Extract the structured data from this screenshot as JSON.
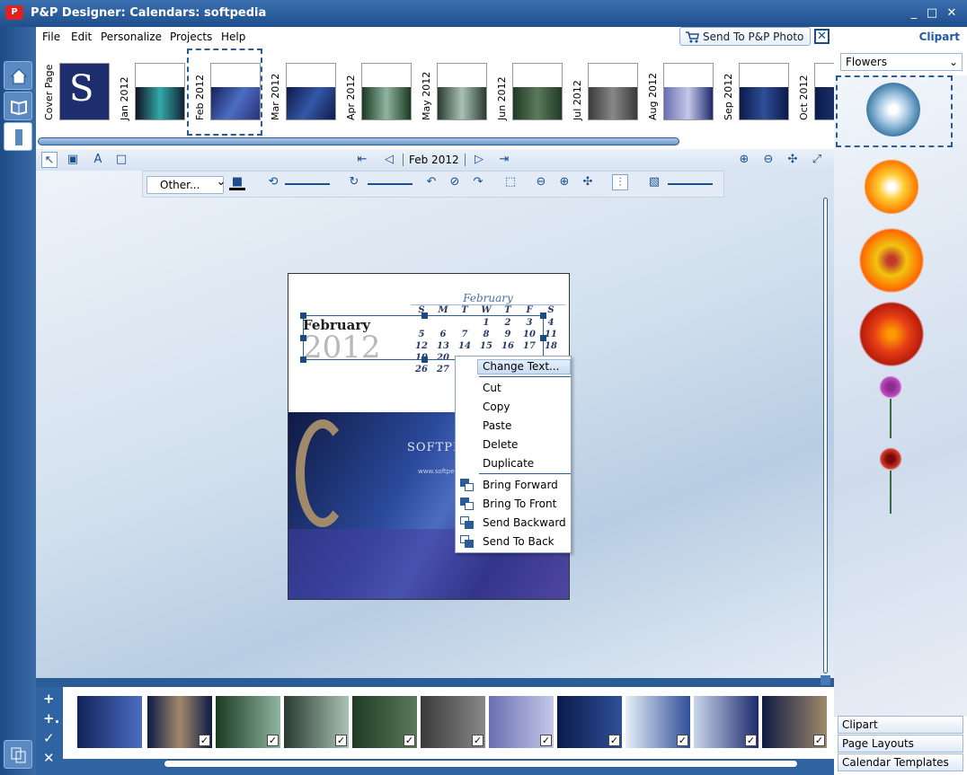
{
  "window": {
    "title": "P&P Designer: Calendars: softpedia"
  },
  "menu": {
    "items": [
      "File",
      "Edit",
      "Personalize",
      "Projects",
      "Help"
    ],
    "send_label": "Send To  P&P Photo"
  },
  "thumbs": [
    {
      "label": "Cover Page"
    },
    {
      "label": "Jan  2012"
    },
    {
      "label": "Feb  2012"
    },
    {
      "label": "Mar  2012"
    },
    {
      "label": "Apr  2012"
    },
    {
      "label": "May  2012"
    },
    {
      "label": "Jun  2012"
    },
    {
      "label": "Jul  2012"
    },
    {
      "label": "Aug  2012"
    },
    {
      "label": "Sep  2012"
    },
    {
      "label": "Oct  2012"
    }
  ],
  "nav": {
    "date": "Feb  2012"
  },
  "toolbar2": {
    "font_select": "Other..."
  },
  "page": {
    "month": "February",
    "year": "2012",
    "mini_title": "February",
    "weekdays": [
      "S",
      "M",
      "T",
      "W",
      "T",
      "F",
      "S"
    ],
    "weeks": [
      [
        "",
        "",
        "",
        "1",
        "2",
        "3",
        "4"
      ],
      [
        "5",
        "6",
        "7",
        "8",
        "9",
        "10",
        "11"
      ],
      [
        "12",
        "13",
        "14",
        "15",
        "16",
        "17",
        "18"
      ],
      [
        "19",
        "20",
        "",
        "",
        "",
        "",
        ""
      ],
      [
        "26",
        "27",
        "2",
        "",
        "",
        "",
        ""
      ]
    ],
    "photo_brand": "SOFTPEDIA",
    "photo_url": "www.softpedia.com"
  },
  "context_menu": {
    "change_text": "Change Text...",
    "cut": "Cut",
    "copy": "Copy",
    "paste": "Paste",
    "delete": "Delete",
    "duplicate": "Duplicate",
    "bring_forward": "Bring Forward",
    "bring_to_front": "Bring To Front",
    "send_backward": "Send Backward",
    "send_to_back": "Send To Back"
  },
  "right_panel": {
    "header": "Clipart",
    "category": "Flowers",
    "tabs": [
      "Clipart",
      "Page Layouts",
      "Calendar Templates"
    ]
  }
}
